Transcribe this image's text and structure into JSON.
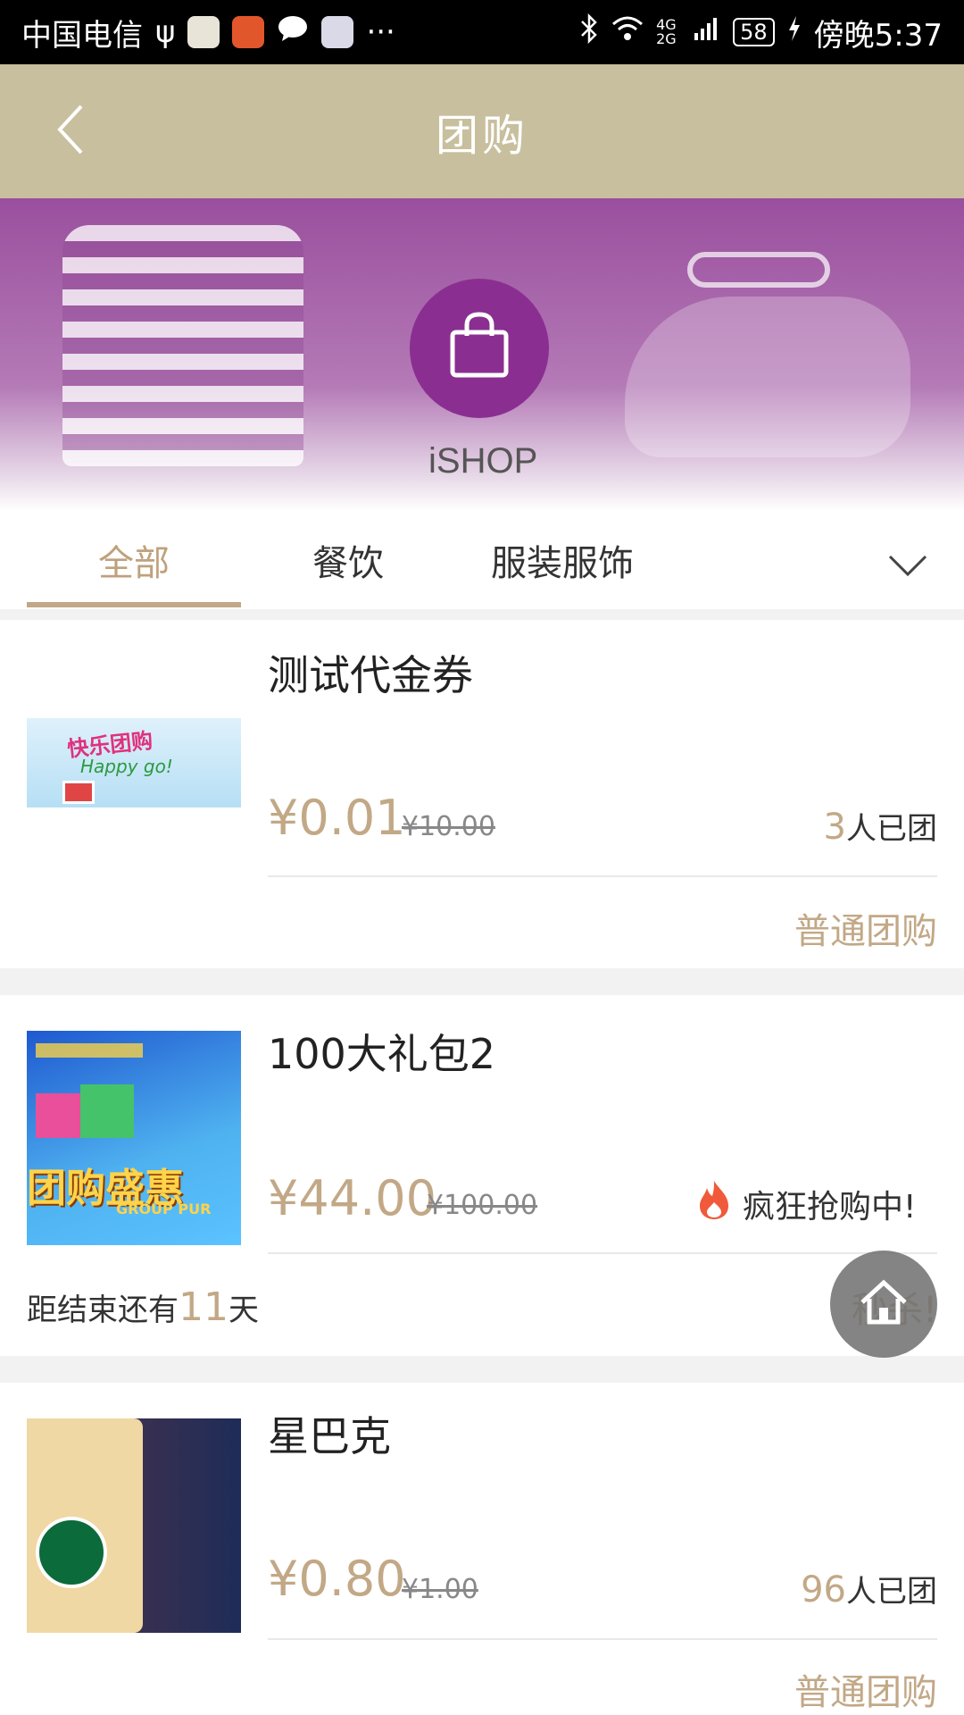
{
  "status": {
    "carrier": "中国电信",
    "usb_icon": "ψ",
    "more": "···",
    "network": "4G 2G",
    "battery": "58",
    "time": "傍晚5:37"
  },
  "header": {
    "title": "团购"
  },
  "banner": {
    "brand": "iSHOP"
  },
  "tabs": [
    {
      "label": "全部"
    },
    {
      "label": "餐饮"
    },
    {
      "label": "服装服饰"
    }
  ],
  "products": [
    {
      "name": "测试代金券",
      "price": "¥0.01",
      "original_price": "¥10.00",
      "joined_count": "3",
      "joined_suffix": "人已团",
      "type": "普通团购",
      "thumb_text_1": "快乐团购",
      "thumb_text_2": "Happy go!"
    },
    {
      "name": "100大礼包2",
      "price": "¥44.00",
      "original_price": "¥100.00",
      "hot_label": "疯狂抢购中!",
      "countdown_prefix": "距结束还有",
      "countdown_days": "11",
      "countdown_suffix": "天",
      "type": "秒杀!",
      "thumb_text_1": "团购盛惠",
      "thumb_text_2": "GROUP PUR"
    },
    {
      "name": "星巴克",
      "price": "¥0.80",
      "original_price": "¥1.00",
      "joined_count": "96",
      "joined_suffix": "人已团",
      "type": "普通团购"
    }
  ],
  "colors": {
    "accent": "#c2a886",
    "header_bg": "#c8bf9e",
    "bag_circle": "#8a2f91"
  }
}
